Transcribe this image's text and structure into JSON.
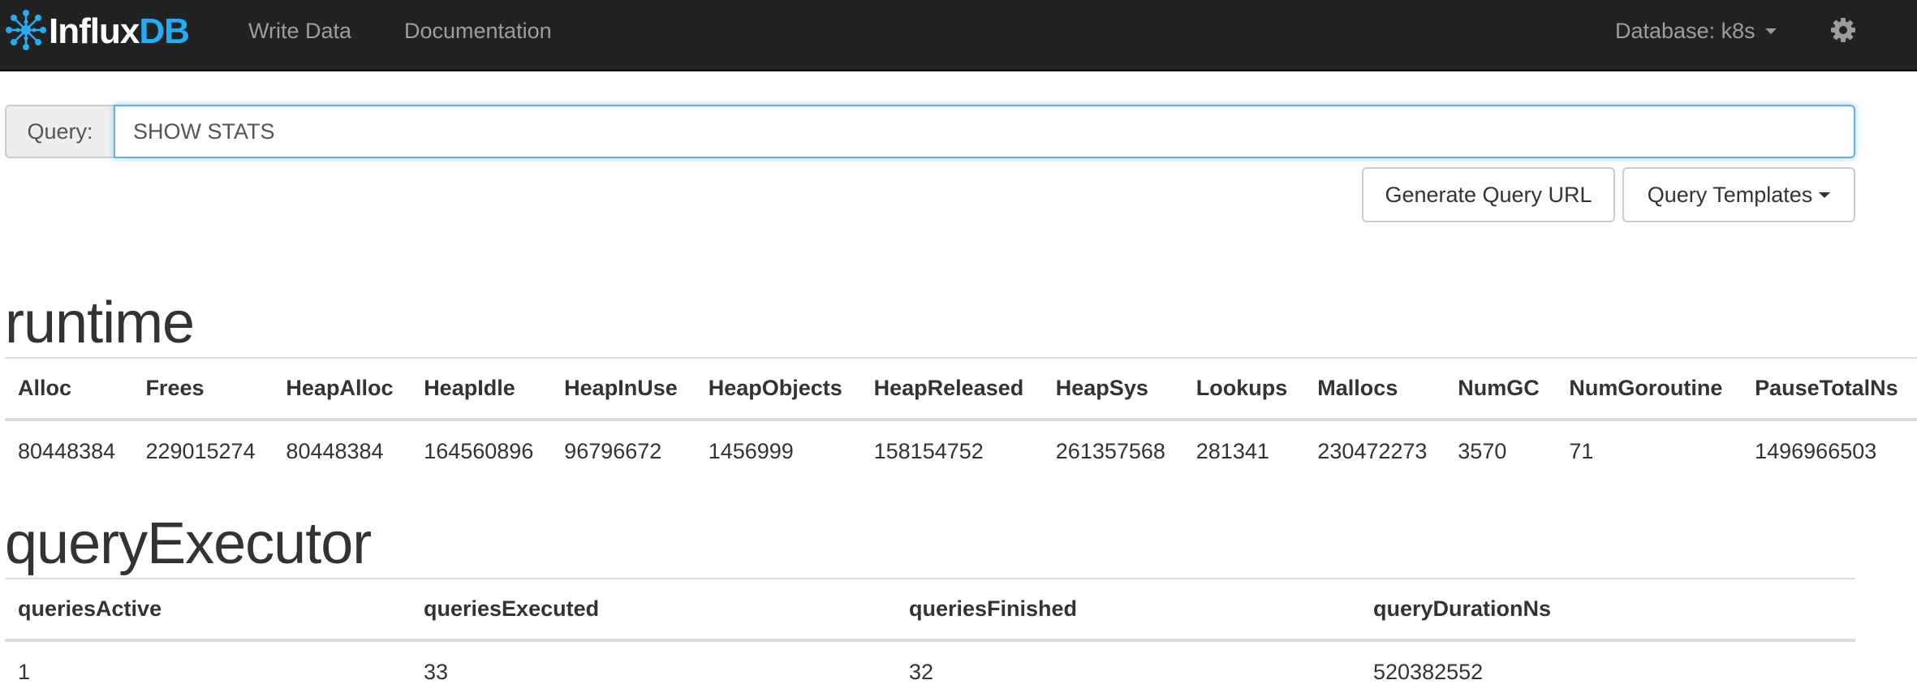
{
  "navbar": {
    "brand_part1": "Influx",
    "brand_part2": "DB",
    "links": [
      "Write Data",
      "Documentation"
    ],
    "database_label": "Database: k8s",
    "icons": {
      "logo": "influxdb-logo-icon",
      "settings": "gear-icon",
      "dropdown": "caret-down-icon"
    },
    "colors": {
      "background": "#222222",
      "link": "#9d9d9d",
      "brand_accent": "#22adf6"
    }
  },
  "query": {
    "label": "Query:",
    "value": "SHOW STATS",
    "generate_url_label": "Generate Query URL",
    "templates_label": "Query Templates"
  },
  "sections": [
    {
      "title": "runtime",
      "columns": [
        "Alloc",
        "Frees",
        "HeapAlloc",
        "HeapIdle",
        "HeapInUse",
        "HeapObjects",
        "HeapReleased",
        "HeapSys",
        "Lookups",
        "Mallocs",
        "NumGC",
        "NumGoroutine",
        "PauseTotalNs"
      ],
      "rows": [
        [
          "80448384",
          "229015274",
          "80448384",
          "164560896",
          "96796672",
          "1456999",
          "158154752",
          "261357568",
          "281341",
          "230472273",
          "3570",
          "71",
          "1496966503"
        ]
      ]
    },
    {
      "title": "queryExecutor",
      "columns": [
        "queriesActive",
        "queriesExecuted",
        "queriesFinished",
        "queryDurationNs"
      ],
      "rows": [
        [
          "1",
          "33",
          "32",
          "520382552"
        ]
      ]
    }
  ]
}
